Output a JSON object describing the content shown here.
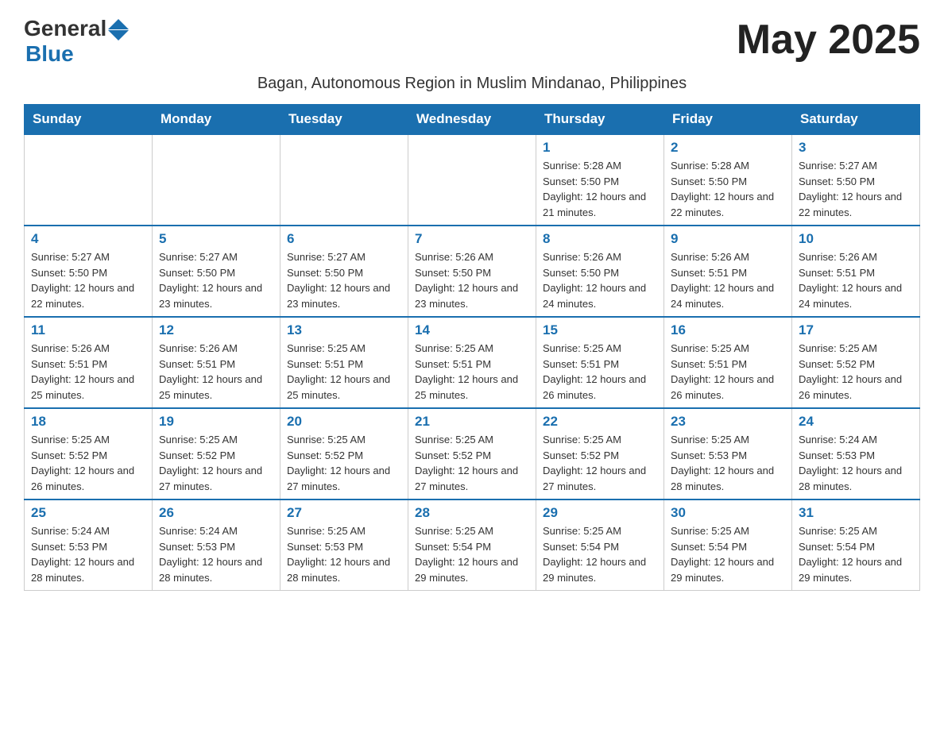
{
  "header": {
    "logo_general": "General",
    "logo_blue": "Blue",
    "month_title": "May 2025",
    "subtitle": "Bagan, Autonomous Region in Muslim Mindanao, Philippines"
  },
  "days_of_week": [
    "Sunday",
    "Monday",
    "Tuesday",
    "Wednesday",
    "Thursday",
    "Friday",
    "Saturday"
  ],
  "weeks": [
    [
      {
        "day": "",
        "info": ""
      },
      {
        "day": "",
        "info": ""
      },
      {
        "day": "",
        "info": ""
      },
      {
        "day": "",
        "info": ""
      },
      {
        "day": "1",
        "info": "Sunrise: 5:28 AM\nSunset: 5:50 PM\nDaylight: 12 hours and 21 minutes."
      },
      {
        "day": "2",
        "info": "Sunrise: 5:28 AM\nSunset: 5:50 PM\nDaylight: 12 hours and 22 minutes."
      },
      {
        "day": "3",
        "info": "Sunrise: 5:27 AM\nSunset: 5:50 PM\nDaylight: 12 hours and 22 minutes."
      }
    ],
    [
      {
        "day": "4",
        "info": "Sunrise: 5:27 AM\nSunset: 5:50 PM\nDaylight: 12 hours and 22 minutes."
      },
      {
        "day": "5",
        "info": "Sunrise: 5:27 AM\nSunset: 5:50 PM\nDaylight: 12 hours and 23 minutes."
      },
      {
        "day": "6",
        "info": "Sunrise: 5:27 AM\nSunset: 5:50 PM\nDaylight: 12 hours and 23 minutes."
      },
      {
        "day": "7",
        "info": "Sunrise: 5:26 AM\nSunset: 5:50 PM\nDaylight: 12 hours and 23 minutes."
      },
      {
        "day": "8",
        "info": "Sunrise: 5:26 AM\nSunset: 5:50 PM\nDaylight: 12 hours and 24 minutes."
      },
      {
        "day": "9",
        "info": "Sunrise: 5:26 AM\nSunset: 5:51 PM\nDaylight: 12 hours and 24 minutes."
      },
      {
        "day": "10",
        "info": "Sunrise: 5:26 AM\nSunset: 5:51 PM\nDaylight: 12 hours and 24 minutes."
      }
    ],
    [
      {
        "day": "11",
        "info": "Sunrise: 5:26 AM\nSunset: 5:51 PM\nDaylight: 12 hours and 25 minutes."
      },
      {
        "day": "12",
        "info": "Sunrise: 5:26 AM\nSunset: 5:51 PM\nDaylight: 12 hours and 25 minutes."
      },
      {
        "day": "13",
        "info": "Sunrise: 5:25 AM\nSunset: 5:51 PM\nDaylight: 12 hours and 25 minutes."
      },
      {
        "day": "14",
        "info": "Sunrise: 5:25 AM\nSunset: 5:51 PM\nDaylight: 12 hours and 25 minutes."
      },
      {
        "day": "15",
        "info": "Sunrise: 5:25 AM\nSunset: 5:51 PM\nDaylight: 12 hours and 26 minutes."
      },
      {
        "day": "16",
        "info": "Sunrise: 5:25 AM\nSunset: 5:51 PM\nDaylight: 12 hours and 26 minutes."
      },
      {
        "day": "17",
        "info": "Sunrise: 5:25 AM\nSunset: 5:52 PM\nDaylight: 12 hours and 26 minutes."
      }
    ],
    [
      {
        "day": "18",
        "info": "Sunrise: 5:25 AM\nSunset: 5:52 PM\nDaylight: 12 hours and 26 minutes."
      },
      {
        "day": "19",
        "info": "Sunrise: 5:25 AM\nSunset: 5:52 PM\nDaylight: 12 hours and 27 minutes."
      },
      {
        "day": "20",
        "info": "Sunrise: 5:25 AM\nSunset: 5:52 PM\nDaylight: 12 hours and 27 minutes."
      },
      {
        "day": "21",
        "info": "Sunrise: 5:25 AM\nSunset: 5:52 PM\nDaylight: 12 hours and 27 minutes."
      },
      {
        "day": "22",
        "info": "Sunrise: 5:25 AM\nSunset: 5:52 PM\nDaylight: 12 hours and 27 minutes."
      },
      {
        "day": "23",
        "info": "Sunrise: 5:25 AM\nSunset: 5:53 PM\nDaylight: 12 hours and 28 minutes."
      },
      {
        "day": "24",
        "info": "Sunrise: 5:24 AM\nSunset: 5:53 PM\nDaylight: 12 hours and 28 minutes."
      }
    ],
    [
      {
        "day": "25",
        "info": "Sunrise: 5:24 AM\nSunset: 5:53 PM\nDaylight: 12 hours and 28 minutes."
      },
      {
        "day": "26",
        "info": "Sunrise: 5:24 AM\nSunset: 5:53 PM\nDaylight: 12 hours and 28 minutes."
      },
      {
        "day": "27",
        "info": "Sunrise: 5:25 AM\nSunset: 5:53 PM\nDaylight: 12 hours and 28 minutes."
      },
      {
        "day": "28",
        "info": "Sunrise: 5:25 AM\nSunset: 5:54 PM\nDaylight: 12 hours and 29 minutes."
      },
      {
        "day": "29",
        "info": "Sunrise: 5:25 AM\nSunset: 5:54 PM\nDaylight: 12 hours and 29 minutes."
      },
      {
        "day": "30",
        "info": "Sunrise: 5:25 AM\nSunset: 5:54 PM\nDaylight: 12 hours and 29 minutes."
      },
      {
        "day": "31",
        "info": "Sunrise: 5:25 AM\nSunset: 5:54 PM\nDaylight: 12 hours and 29 minutes."
      }
    ]
  ]
}
